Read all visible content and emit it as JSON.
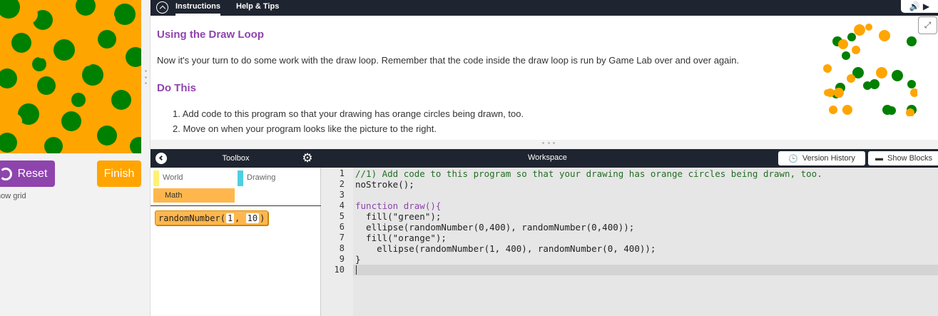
{
  "instructions": {
    "tab_instructions": "Instructions",
    "tab_help": "Help & Tips",
    "title": "Using the Draw Loop",
    "text": "Now it's your turn to do some work with the draw loop. Remember that the code inside the draw loop is run by Game Lab over and over again.",
    "do_this": "Do This",
    "steps": [
      "1. Add code to this program so that your drawing has orange circles being drawn, too.",
      "2. Move on when your program looks like the picture to the right."
    ]
  },
  "visualization": {
    "reset_label": "Reset",
    "finish_label": "Finish",
    "show_grid_label": "how grid"
  },
  "toolbox": {
    "title": "Toolbox",
    "categories": [
      "World",
      "Drawing",
      "Math"
    ],
    "block_name": "randomNumber",
    "block_arg1": "1",
    "block_arg2": "10"
  },
  "workspace": {
    "title": "Workspace",
    "version_history_label": "Version History",
    "show_blocks_label": "Show Blocks",
    "line_numbers": [
      "1",
      "2",
      "3",
      "4",
      "5",
      "6",
      "7",
      "8",
      "9",
      "10"
    ],
    "code_lines": [
      "//1) Add code to this program so that your drawing has orange circles being drawn, too.",
      "noStroke();",
      "",
      "function draw(){",
      "  fill(\"green\");",
      "  ellipse(randomNumber(0,400), randomNumber(0,400));",
      "  fill(\"orange\");",
      "    ellipse(randomNumber(1, 400), randomNumber(0, 400));",
      "}",
      ""
    ]
  },
  "colors": {
    "accent_purple": "#8e44ad",
    "finish_orange": "#ffa400",
    "header_dark": "#1f2530",
    "green_circle": "#008000",
    "orange_circle": "#ffa500"
  },
  "icons": [
    "chevron-up-icon",
    "audio-icon",
    "play-icon",
    "image-icon",
    "chevron-left-icon",
    "gear-icon",
    "history-icon",
    "blocks-icon",
    "reset-icon"
  ]
}
